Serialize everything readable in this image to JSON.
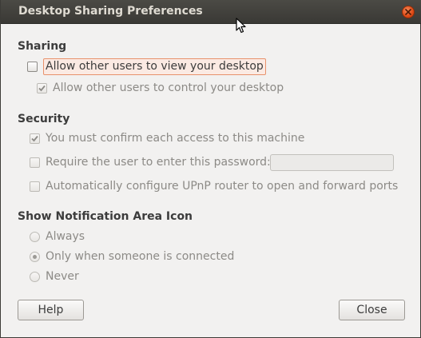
{
  "window": {
    "title": "Desktop Sharing Preferences"
  },
  "sharing": {
    "heading": "Sharing",
    "allow_view": {
      "label": "Allow other users to view your desktop",
      "checked": false
    },
    "allow_control": {
      "label": "Allow other users to control your desktop",
      "checked": true
    }
  },
  "security": {
    "heading": "Security",
    "confirm_access": {
      "label": "You must confirm each access to this machine",
      "checked": true
    },
    "require_password": {
      "label": "Require the user to enter this password:",
      "checked": false
    },
    "password_value": "",
    "upnp": {
      "label": "Automatically configure UPnP router to open and forward ports",
      "checked": false
    }
  },
  "notification": {
    "heading": "Show Notification Area Icon",
    "options": [
      {
        "label": "Always",
        "selected": false
      },
      {
        "label": "Only when someone is connected",
        "selected": true
      },
      {
        "label": "Never",
        "selected": false
      }
    ]
  },
  "buttons": {
    "help": "Help",
    "close": "Close"
  },
  "colors": {
    "titlebar": "#3c3b37",
    "close_button": "#df4a16",
    "focus_border": "#e8926c",
    "window_bg": "#f2f1f0"
  }
}
